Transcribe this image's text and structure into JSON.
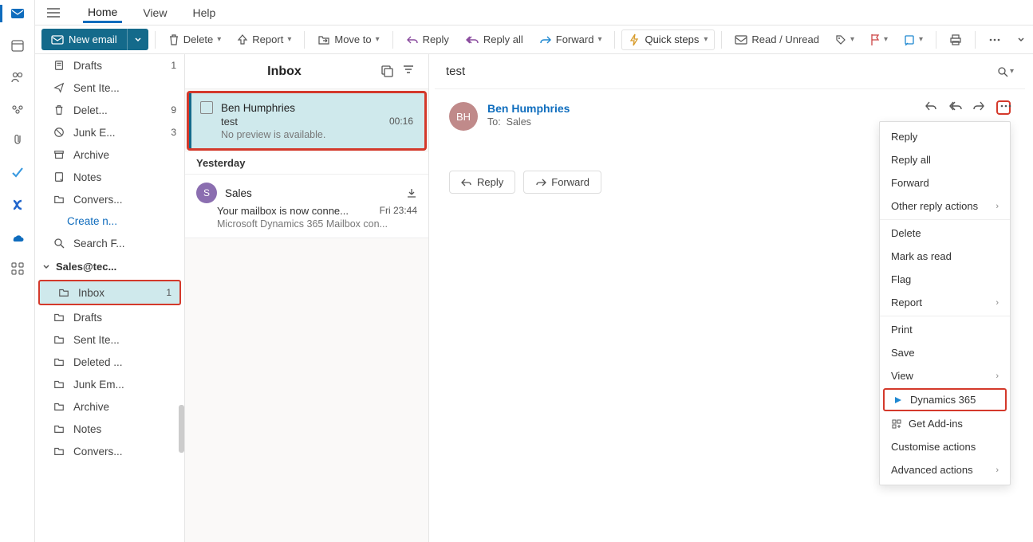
{
  "menu": {
    "items": [
      "Home",
      "View",
      "Help"
    ],
    "active": 0
  },
  "toolbar": {
    "new_email": "New email",
    "delete": "Delete",
    "report": "Report",
    "move_to": "Move to",
    "reply": "Reply",
    "reply_all": "Reply all",
    "forward": "Forward",
    "quick_steps": "Quick steps",
    "read_unread": "Read / Unread"
  },
  "folders1": [
    {
      "icon": "draft",
      "label": "Drafts",
      "count": "1"
    },
    {
      "icon": "sent",
      "label": "Sent Ite...",
      "count": ""
    },
    {
      "icon": "trash",
      "label": "Delet...",
      "count": "9"
    },
    {
      "icon": "junk",
      "label": "Junk E...",
      "count": "3"
    },
    {
      "icon": "archive",
      "label": "Archive",
      "count": ""
    },
    {
      "icon": "note",
      "label": "Notes",
      "count": ""
    },
    {
      "icon": "folder",
      "label": "Convers...",
      "count": ""
    }
  ],
  "create_link": "Create n...",
  "search_folder": "Search F...",
  "account": "Sales@tec...",
  "folders2": [
    {
      "icon": "folder",
      "label": "Inbox",
      "count": "1",
      "highlighted": true
    },
    {
      "icon": "folder",
      "label": "Drafts",
      "count": ""
    },
    {
      "icon": "folder",
      "label": "Sent Ite...",
      "count": ""
    },
    {
      "icon": "folder",
      "label": "Deleted ...",
      "count": ""
    },
    {
      "icon": "folder",
      "label": "Junk Em...",
      "count": ""
    },
    {
      "icon": "folder",
      "label": "Archive",
      "count": ""
    },
    {
      "icon": "folder",
      "label": "Notes",
      "count": ""
    },
    {
      "icon": "folder",
      "label": "Convers...",
      "count": ""
    }
  ],
  "msg_list": {
    "title": "Inbox",
    "items": [
      {
        "sender": "Ben Humphries",
        "subject": "test",
        "time": "00:16",
        "preview": "No preview is available.",
        "selected": true,
        "checkbox": true
      },
      {
        "group": "Yesterday"
      },
      {
        "sender": "Sales",
        "subject": "Your mailbox is now conne...",
        "time": "Fri 23:44",
        "preview": "Microsoft Dynamics 365 Mailbox con...",
        "avatar": "S",
        "download": true
      }
    ]
  },
  "reading": {
    "subject": "test",
    "sender_name": "Ben Humphries",
    "sender_initials": "BH",
    "to_label": "To:",
    "to_value": "Sales",
    "reply_btn": "Reply",
    "forward_btn": "Forward"
  },
  "context_menu": [
    {
      "label": "Reply"
    },
    {
      "label": "Reply all"
    },
    {
      "label": "Forward"
    },
    {
      "label": "Other reply actions",
      "chev": true
    },
    {
      "divider": true
    },
    {
      "label": "Delete"
    },
    {
      "label": "Mark as read"
    },
    {
      "label": "Flag"
    },
    {
      "label": "Report",
      "chev": true
    },
    {
      "divider": true
    },
    {
      "label": "Print"
    },
    {
      "label": "Save"
    },
    {
      "label": "View",
      "chev": true
    },
    {
      "label": "Dynamics 365",
      "icon": "d365",
      "highlighted": true
    },
    {
      "label": "Get Add-ins",
      "icon": "addins"
    },
    {
      "label": "Customise actions"
    },
    {
      "label": "Advanced actions",
      "chev": true
    }
  ]
}
